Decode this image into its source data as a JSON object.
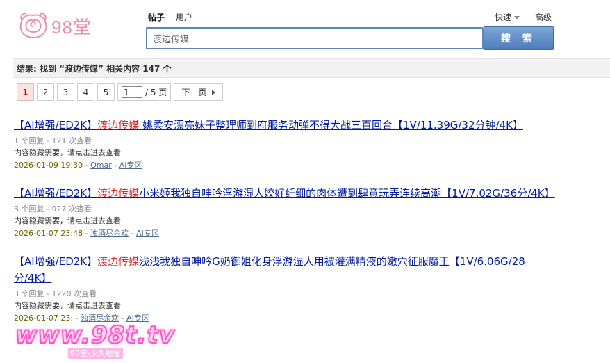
{
  "site": {
    "logo_text": "98堂"
  },
  "tabs": [
    {
      "label": "帖子",
      "active": true
    },
    {
      "label": "用户",
      "active": false
    }
  ],
  "quick": {
    "menu_label": "快速",
    "advanced_label": "高级"
  },
  "search": {
    "value": "渡边传媒",
    "button_label": "搜 索"
  },
  "result_summary": "结果: 找到 “渡边传媒” 相关内容 147 个",
  "pager": {
    "pages": [
      "1",
      "2",
      "3",
      "4",
      "5"
    ],
    "current": "1",
    "input_value": "1",
    "total_label": "/ 5 页",
    "next_label": "下一页"
  },
  "results": [
    {
      "prefix": "【AI增强/ED2K】",
      "keyword": "渡边传媒",
      "rest": " 姚柔安漂亮妹子整理师到府服务动弹不得大战三百回合【1V/11.39G/32分钟/4K】",
      "meta": "1 个回复 - 121 次查看",
      "desc": "内容隐藏需要，请点击进去查看",
      "date": "2026-01-09 19:30",
      "sep1": " - ",
      "author": "Omar",
      "sep2": " - ",
      "forum": "AI专区"
    },
    {
      "prefix": "【AI增强/ED2K】",
      "keyword": "渡边传媒",
      "rest": "小米姬我独自呻吟浮游湿人姣好纤细的肉体遭到肆意玩弄连续高潮【1V/7.02G/36分/4K】",
      "meta": "3 个回复 - 927 次查看",
      "desc": "内容隐藏需要，请点击进去查看",
      "date": "2026-01-07 23:48",
      "sep1": " - ",
      "author": "浊酒尽余欢",
      "sep2": " - ",
      "forum": "AI专区"
    },
    {
      "prefix": "【AI增强/ED2K】",
      "keyword": "渡边传媒",
      "rest": "浅浅我独自呻吟G奶御姐化身浮游湿人用被灌满精液的嫩穴征服魔王【1V/6.06G/28分/4K】",
      "meta": "3 个回复 - 1220 次查看",
      "desc": "内容隐藏需要，请点击进去查看",
      "date": "2026-01-07 23:",
      "sep1": " - ",
      "author": "浊酒尽余欢",
      "sep2": " - ",
      "forum": "AI专区"
    }
  ],
  "watermark": {
    "text": "www.98t.tv",
    "sub": "98堂·永久地址"
  },
  "colors": {
    "accent": "#4d7cbb",
    "keyword": "#e02b2b",
    "link": "#001ba0",
    "logo": "#ee8fa9"
  }
}
